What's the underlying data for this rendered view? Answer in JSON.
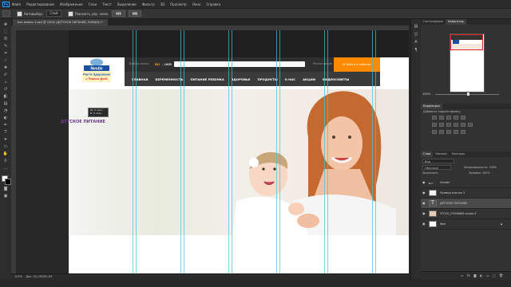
{
  "app": {
    "logo": "Ps",
    "menu": [
      "Файл",
      "Редактирование",
      "Изображение",
      "Слои",
      "Текст",
      "Выделение",
      "Фильтр",
      "3D",
      "Просмотр",
      "Окно",
      "Справка"
    ]
  },
  "options": {
    "autoselect_label": "Автовыбор:",
    "autoselect_value": "Слой",
    "show_controls_label": "Показать упр. элем."
  },
  "document": {
    "tab_title": "Без имени-1.psd @ 100% (ДЕТСКОЕ ПИТАНИЕ, RGB/8#) *"
  },
  "site": {
    "logo": {
      "brand": "Nestle",
      "line1": "Расти Здоровым",
      "line2": "с Первых Дней"
    },
    "search_label": "Выбор языка",
    "lang_ru": "RU",
    "lang_sep": "|",
    "lang_ukr": "UKR",
    "register": "Регистрация",
    "enter_button": "Войти в кабинет",
    "nav": [
      "ГЛАВНАЯ",
      "БЕРЕМЕННОСТЬ",
      "ПИТАНИЕ РЕБЕНКА",
      "ЗДОРОВЬЕ",
      "ПРОДУКТЫ",
      "О НАС",
      "АКЦИИ",
      "ВИДЕОСОВЕТЫ"
    ]
  },
  "canvas": {
    "side_label": "ДЕТСКОЕ ПИТАНИЕ",
    "tooltip_line1": "Ш: 0 пикс.",
    "tooltip_line2": "В: 0 пикс."
  },
  "status": {
    "zoom": "100%",
    "doc_size": "Док: 20,2M/36,1M"
  },
  "panels": {
    "top_tabs": [
      "Гистограмма",
      "Навигатор"
    ],
    "nav_zoom": "100%",
    "corrections_title": "Коррекция",
    "corrections_sub": "Добавить корректировку",
    "layers_tabs": [
      "Слои",
      "Каналы",
      "Контуры"
    ],
    "kind_label": "Вид",
    "blend_mode": "Обычные",
    "opacity_label": "Непрозрачность: 100%",
    "lock_label": "Закрепить:",
    "fill_label": "Заливка: 100%",
    "layers": [
      {
        "name": "Header",
        "selected": false
      },
      {
        "name": "Прямоугольник 3",
        "selected": false
      },
      {
        "name": "ДЕТСКОЕ ПИТАНИЕ",
        "selected": true
      },
      {
        "name": "STOCK_23906869 копия 4",
        "selected": false
      },
      {
        "name": "Фон",
        "selected": false
      }
    ]
  },
  "colors": {
    "accent_orange": "#ff8a00",
    "guide_cyan": "#3cc8dc",
    "nav_bg": "#3a3a3a"
  }
}
